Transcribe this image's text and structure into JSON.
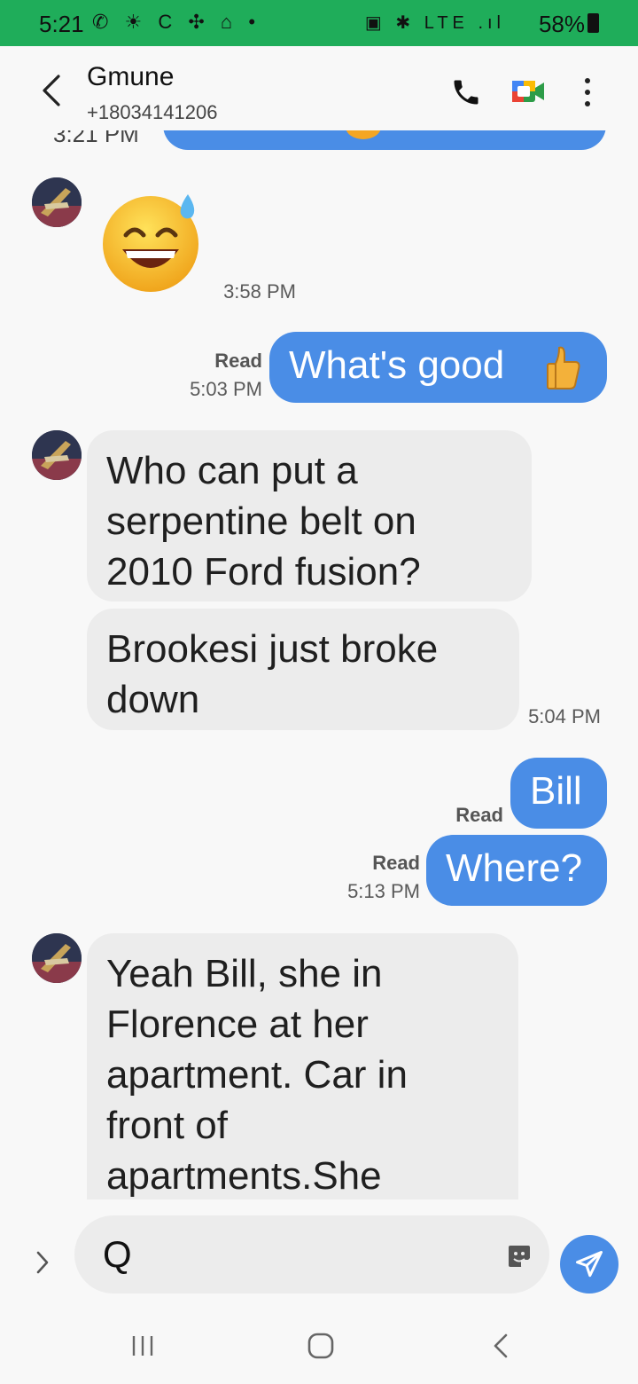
{
  "status_bar": {
    "time": "5:21",
    "left_icons": "✆ ☀ C ✣ ⌂ •",
    "right_icons": "▣ ✱ LTE .ıl",
    "battery": "58%"
  },
  "header": {
    "contact_name": "Gmune",
    "phone_number": "+18034141206"
  },
  "colors": {
    "status_bar": "#1fad5a",
    "outgoing_bubble": "#4a8de6",
    "incoming_bubble": "#ececec"
  },
  "messages": {
    "partial_top_time": "3:21 PM",
    "emoji_time": "3:58 PM",
    "whats_good": {
      "text": "What's good",
      "status": "Read",
      "time": "5:03 PM"
    },
    "serpentine": "Who can put a serpentine belt on 2010 Ford fusion?",
    "brookesi": "Brookesi just broke down",
    "incoming_time_1": "5:04 PM",
    "bill": {
      "text": "Bill",
      "status": "Read"
    },
    "where": {
      "text": "Where?",
      "status": "Read",
      "time": "5:13 PM"
    },
    "yeah_bill": "Yeah Bill, she in Florence at her apartment. Car in front of apartments.She"
  },
  "composer": {
    "input_value": "Q"
  }
}
